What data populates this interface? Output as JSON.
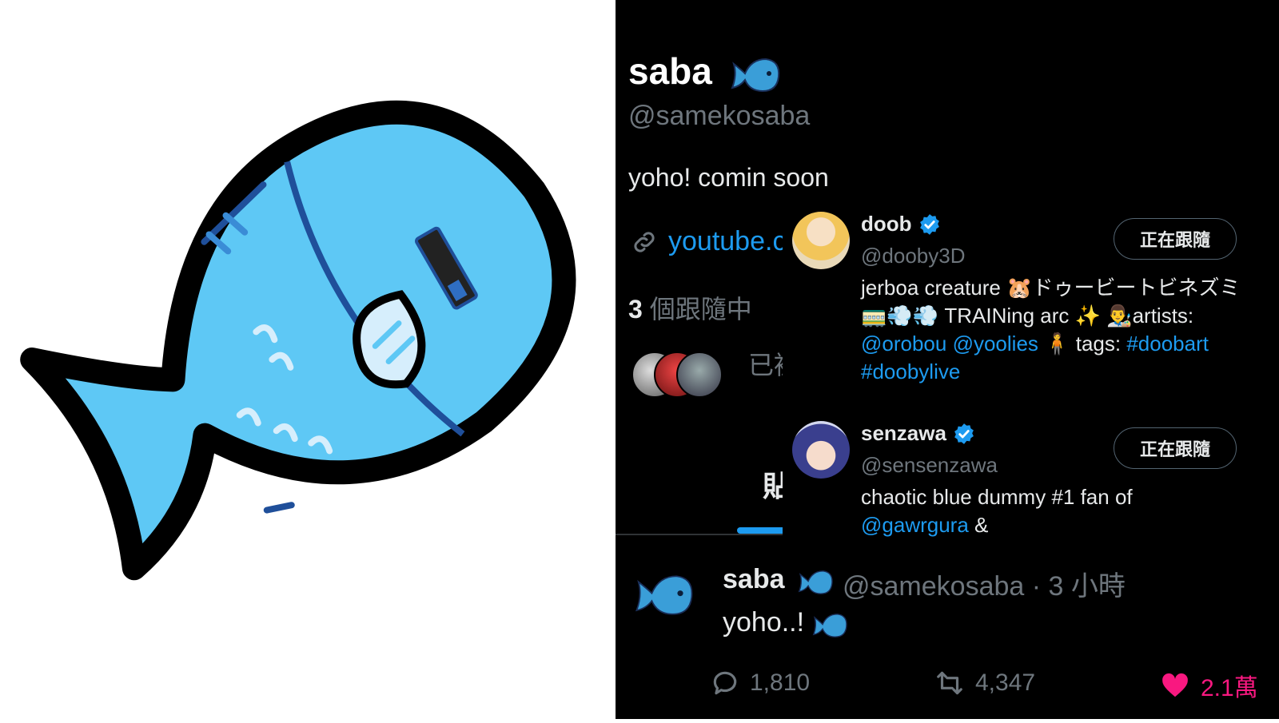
{
  "profile": {
    "name": "saba",
    "handle": "@samekosaba",
    "bio": "yoho! comin soon",
    "link_text": "youtube.c",
    "following_count": "3",
    "following_label": " 個跟隨中",
    "followers_text": "已被"
  },
  "tabs": {
    "posts_label": "貼"
  },
  "tweet": {
    "name": "saba",
    "meta": "@samekosaba · 3 小時",
    "text": "yoho..!",
    "replies": "1,810",
    "retweets": "4,347",
    "likes": "2.1萬"
  },
  "popup_users": [
    {
      "name": "doob",
      "handle": "@dooby3D",
      "follow_label": "正在跟隨",
      "bio_text_1": "jerboa creature 🐹ドゥービートビネズミ 🚃💨💨 TRAINing arc ✨ 👨‍🎨artists: ",
      "mention_1": "@orobou",
      "mention_2": " @yoolies",
      "bio_text_2": " 🧍 tags: ",
      "mention_3": "#doobart",
      "mention_4": " #doobylive"
    },
    {
      "name": "senzawa",
      "handle": "@sensenzawa",
      "follow_label": "正在跟隨",
      "bio_text_1": "chaotic blue dummy #1 fan of ",
      "mention_1": "@gawrgura",
      "bio_text_2": " &"
    }
  ],
  "colors": {
    "accent": "#1d9bf0",
    "like": "#f91880",
    "background": "#000000",
    "fish_body": "#5ec8f5"
  },
  "icons": [
    "fish-icon",
    "link-icon",
    "verified-badge-icon",
    "reply-icon",
    "retweet-icon",
    "heart-icon"
  ]
}
